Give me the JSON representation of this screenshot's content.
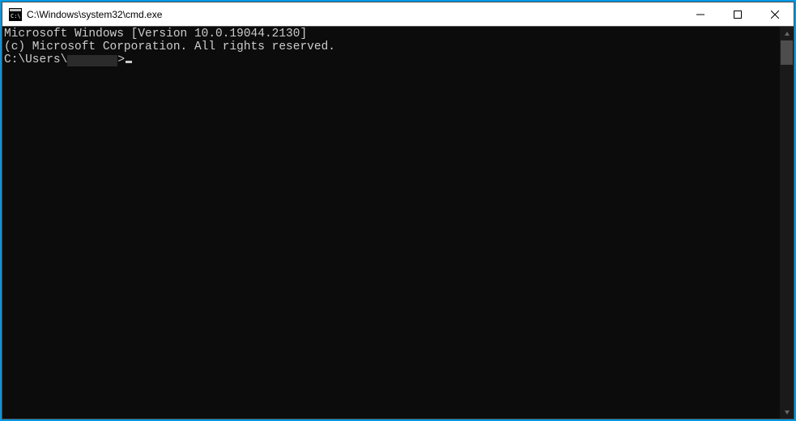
{
  "window": {
    "title": "C:\\Windows\\system32\\cmd.exe"
  },
  "terminal": {
    "line1": "Microsoft Windows [Version 10.0.19044.2130]",
    "line2": "(c) Microsoft Corporation. All rights reserved.",
    "blank": "",
    "prompt_prefix": "C:\\Users\\",
    "prompt_suffix": ">"
  }
}
